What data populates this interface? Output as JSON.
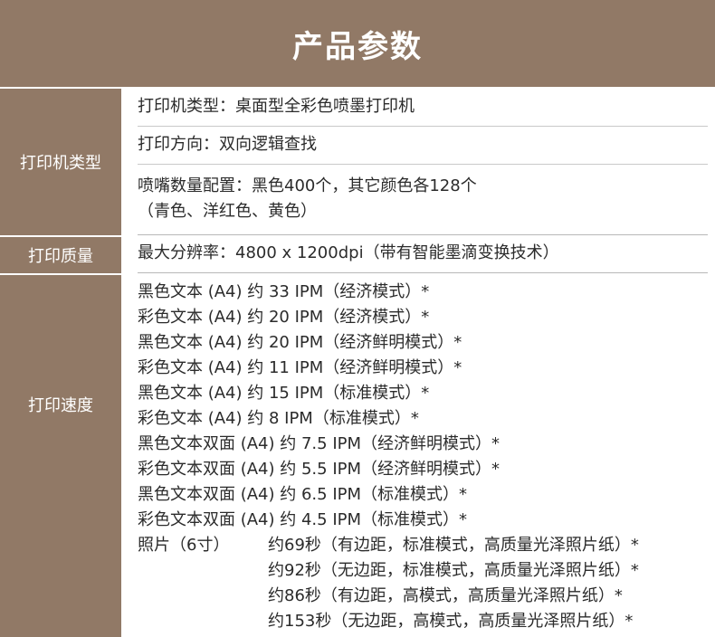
{
  "title": "产品参数",
  "sections": {
    "printer_type": {
      "label": "打印机类型",
      "rows": [
        "打印机类型：桌面型全彩色喷墨打印机",
        "打印方向：双向逻辑查找"
      ],
      "nozzle_line1": "喷嘴数量配置：黑色400个，其它颜色各128个",
      "nozzle_line2": "（青色、洋红色、黄色）"
    },
    "print_quality": {
      "label": "打印质量",
      "value": "最大分辨率：4800 x 1200dpi（带有智能墨滴变换技术）"
    },
    "print_speed": {
      "label": "打印速度",
      "lines": [
        "黑色文本 (A4)  约 33 IPM（经济模式）*",
        "彩色文本 (A4)  约 20 IPM（经济模式）*",
        "黑色文本 (A4)  约 20 IPM（经济鲜明模式）*",
        "彩色文本 (A4)  约 11 IPM（经济鲜明模式）*",
        "黑色文本 (A4)  约 15 IPM（标准模式）*",
        "彩色文本 (A4)  约 8 IPM（标准模式）*",
        "黑色文本双面 (A4)    约 7.5 IPM（经济鲜明模式）*",
        "彩色文本双面 (A4)    约 5.5 IPM（经济鲜明模式）*",
        "黑色文本双面 (A4)    约 6.5 IPM（标准模式）*",
        "彩色文本双面 (A4)    约 4.5 IPM（标准模式）*"
      ],
      "photo_label": "照片（6寸）",
      "photo_lines": [
        "约69秒（有边距，标准模式，高质量光泽照片纸）*",
        "约92秒（无边距，标准模式，高质量光泽照片纸）*",
        "约86秒（有边距，高模式，高质量光泽照片纸）*",
        "约153秒（无边距，高模式，高质量光泽照片纸）*"
      ]
    }
  }
}
